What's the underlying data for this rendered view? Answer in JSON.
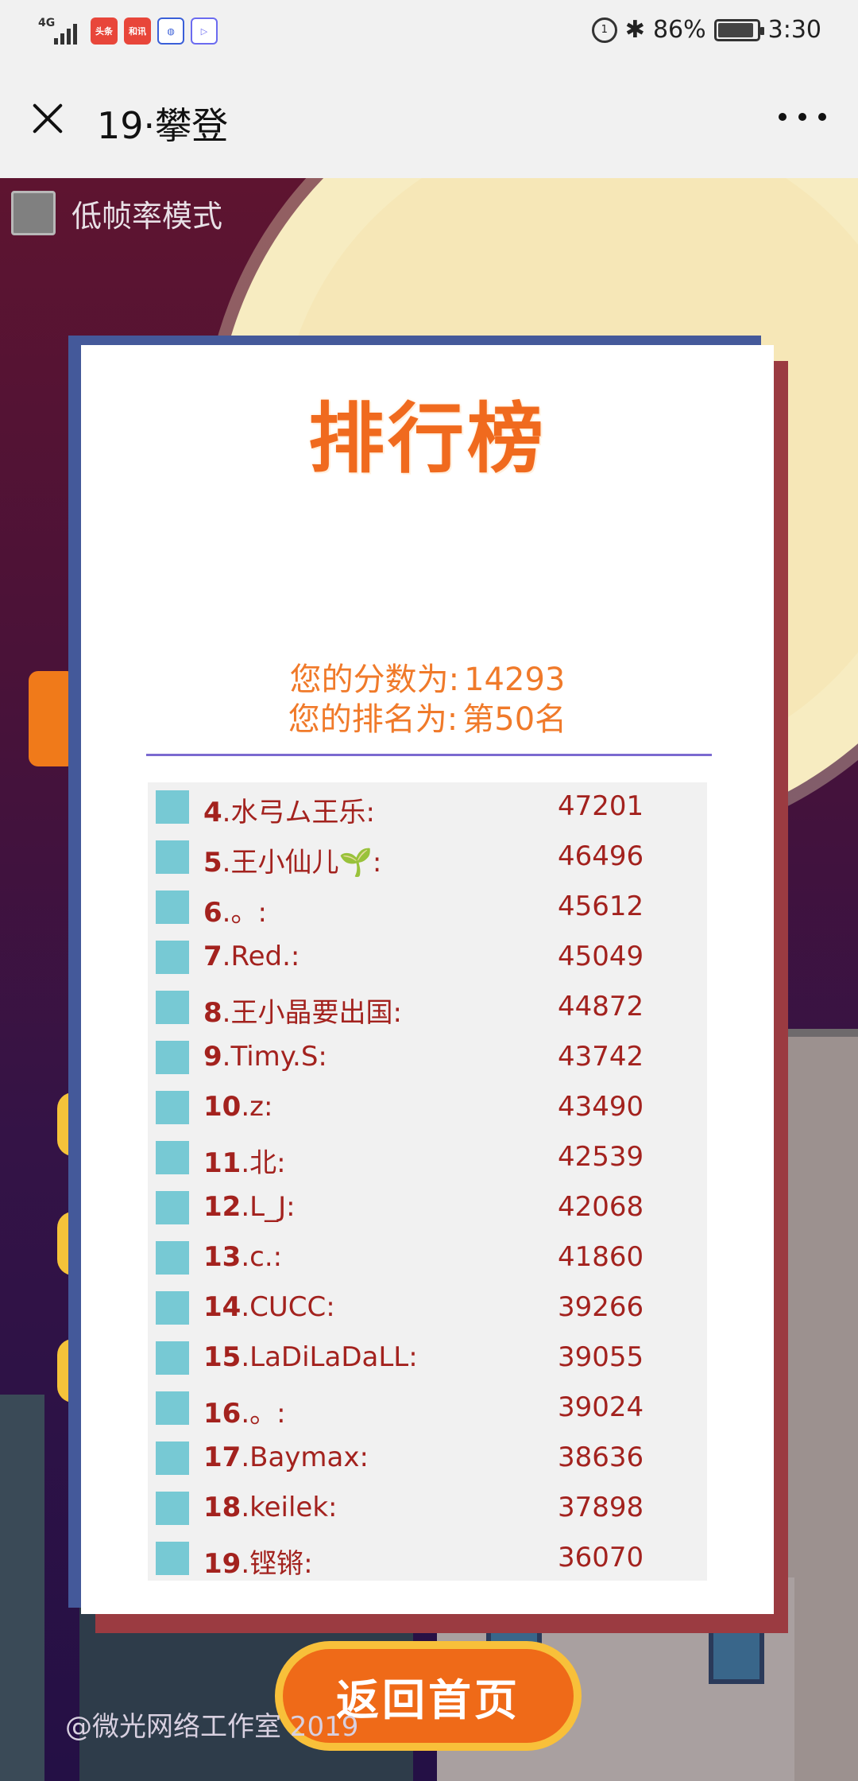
{
  "status_bar": {
    "network": "4G",
    "apps": [
      {
        "icon": "toutiao-app-icon",
        "label": "头条",
        "color": "#e8463a"
      },
      {
        "icon": "hexun-app-icon",
        "label": "和讯",
        "color": "#e8463a"
      },
      {
        "icon": "browser-app-icon",
        "label": "",
        "color": "#ffffff"
      },
      {
        "icon": "video-app-icon",
        "label": "",
        "color": "#6b6bf0"
      }
    ],
    "battery": "86%",
    "time": "3:30"
  },
  "header": {
    "title": "19·攀登"
  },
  "game": {
    "low_frame_label": "低帧率模式",
    "copyright": "@微光网络工作室 2019",
    "leaderboard": {
      "title": "排行榜",
      "score_label": "您的分数为:",
      "score_value": "14293",
      "rank_label": "您的排名为:",
      "rank_value": "第50名",
      "rows": [
        {
          "rank": "4",
          "name": ".水弓ム王乐:",
          "score": "47201"
        },
        {
          "rank": "5",
          "name": ".王小仙儿🌱:",
          "score": "46496"
        },
        {
          "rank": "6",
          "name": ".。:",
          "score": "45612"
        },
        {
          "rank": "7",
          "name": ".Red.:",
          "score": "45049"
        },
        {
          "rank": "8",
          "name": ".王小晶要出国:",
          "score": "44872"
        },
        {
          "rank": "9",
          "name": ".Timy.S:",
          "score": "43742"
        },
        {
          "rank": "10",
          "name": ".z:",
          "score": "43490"
        },
        {
          "rank": "11",
          "name": ".北:",
          "score": "42539"
        },
        {
          "rank": "12",
          "name": ".L_J:",
          "score": "42068"
        },
        {
          "rank": "13",
          "name": ".c.:",
          "score": "41860"
        },
        {
          "rank": "14",
          "name": ".CUCC:",
          "score": "39266"
        },
        {
          "rank": "15",
          "name": ".LaDiLaDaLL:",
          "score": "39055"
        },
        {
          "rank": "16",
          "name": ".。:",
          "score": "39024"
        },
        {
          "rank": "17",
          "name": ".Baymax:",
          "score": "38636"
        },
        {
          "rank": "18",
          "name": ".keilek:",
          "score": "37898"
        },
        {
          "rank": "19",
          "name": ".铿锵:",
          "score": "36070"
        }
      ],
      "back_button": "返回首页"
    }
  }
}
